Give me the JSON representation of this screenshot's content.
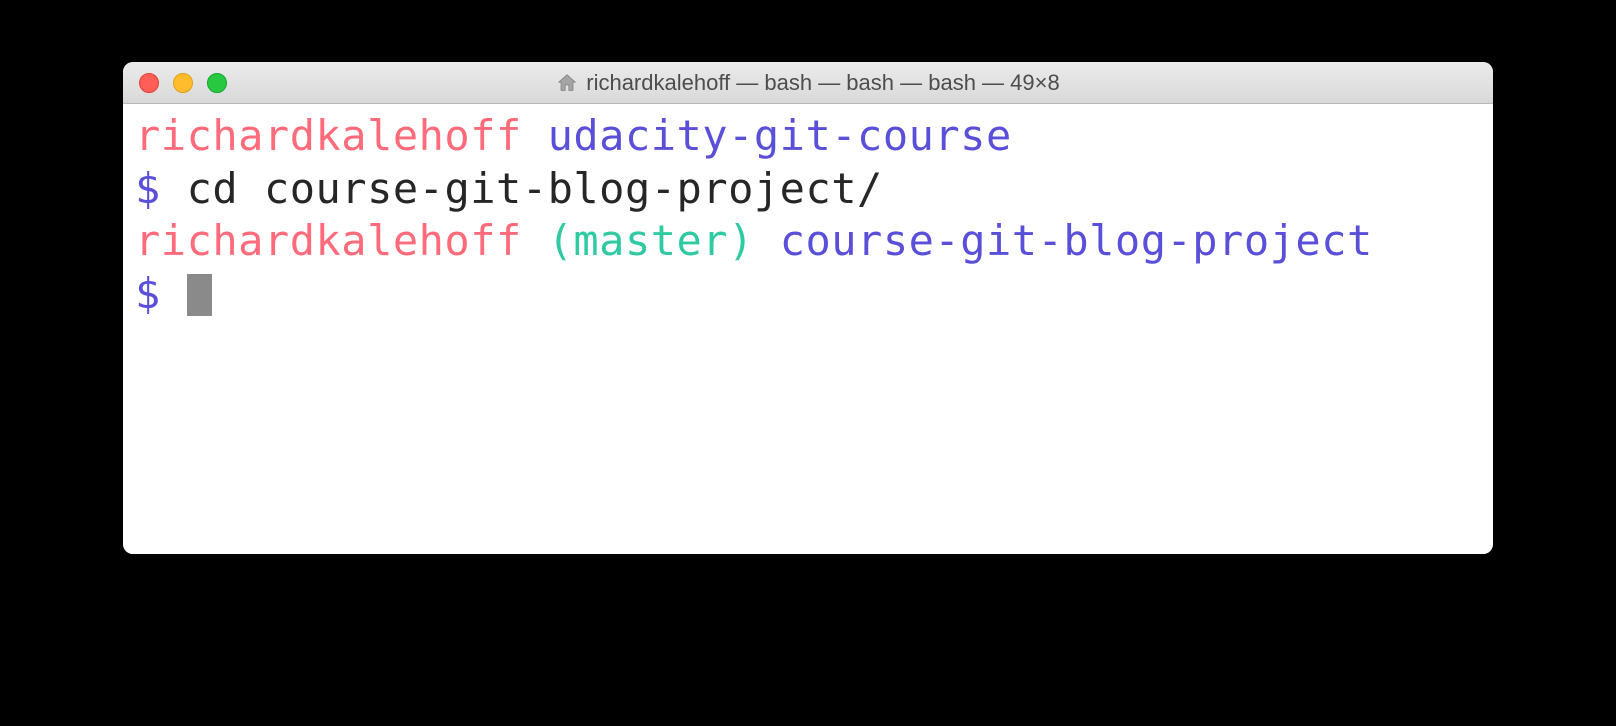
{
  "window": {
    "title": "richardkalehoff — bash — bash — bash — 49×8"
  },
  "colors": {
    "user": "#ff6b7a",
    "dir": "#5a4fd8",
    "branch": "#2fc9a2",
    "prompt": "#5a4fd8"
  },
  "lines": {
    "l1_user": "richardkalehoff",
    "l1_sep": " ",
    "l1_dir": "udacity-git-course",
    "l2_prompt": "$",
    "l2_sep": " ",
    "l2_cmd": "cd course-git-blog-project/",
    "l3_user": "richardkalehoff",
    "l3_sep1": " ",
    "l3_branch": "(master)",
    "l3_sep2": " ",
    "l3_dir": "course-git-blog-project",
    "l4_prompt": "$",
    "l4_sep": " "
  }
}
